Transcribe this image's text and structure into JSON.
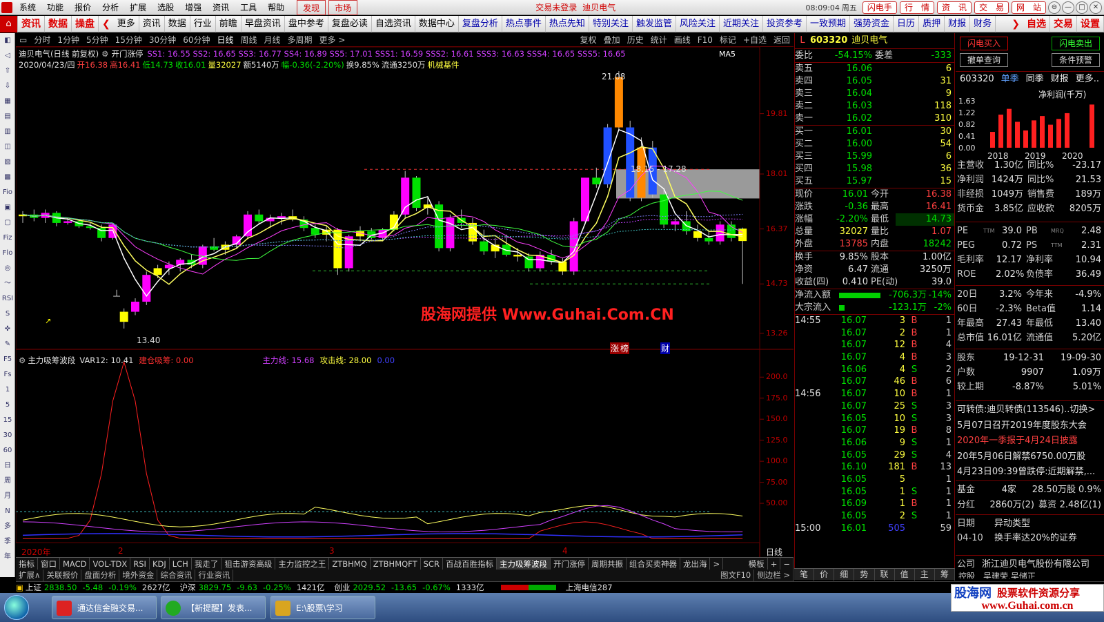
{
  "menubar": {
    "items": [
      "系统",
      "功能",
      "报价",
      "分析",
      "扩展",
      "选股",
      "增强",
      "资讯",
      "工具",
      "帮助"
    ],
    "discover": "发现",
    "market": "市场",
    "status": "交易未登录",
    "stock_name": "迪贝电气",
    "time": "08:09:04",
    "weekday": "周五",
    "buttons": [
      "闪电手",
      "行　情",
      "资　讯",
      "交　易",
      "网　站"
    ]
  },
  "toolbar": {
    "hot": [
      "资讯",
      "数据",
      "操盘"
    ],
    "items": [
      "更多",
      "资讯",
      "数据",
      "行业",
      "前瞻",
      "早盘资讯",
      "盘中参考",
      "复盘必读",
      "自选资讯",
      "数据中心",
      "复盘分析",
      "热点事件",
      "热点先知",
      "特别关注",
      "触发监管",
      "风险关注",
      "近期关注",
      "投资参考",
      "一致预期",
      "强势资金",
      "日历",
      "质押",
      "财报",
      "财务"
    ],
    "right": [
      "自选",
      "交易",
      "设置"
    ]
  },
  "lefttb": [
    "◧",
    "◁",
    "⇧",
    "⇩",
    "▦",
    "▤",
    "▥",
    "◫",
    "▨",
    "▩",
    "Fio",
    "▣",
    "▢",
    "Fiz",
    "Flo",
    "◎",
    "〜",
    "RSI",
    "S",
    "✜",
    "✎",
    "F5",
    "Fs",
    "1",
    "5",
    "15",
    "30",
    "60",
    "日",
    "周",
    "月",
    "N",
    "多",
    "季",
    "年"
  ],
  "periods": {
    "items": [
      "分时",
      "1分钟",
      "5分钟",
      "15分钟",
      "30分钟",
      "60分钟",
      "日线",
      "周线",
      "月线",
      "多周期",
      "更多 >"
    ],
    "tools": [
      "复权",
      "叠加",
      "历史",
      "统计",
      "画线",
      "F10",
      "标记",
      "+自选",
      "返回"
    ]
  },
  "chart_info": {
    "title": "迪贝电气(日线 前复权)",
    "indicator": "开门涨停",
    "ss": "SS1: 16.55  SS2: 16.65  SS3: 16.77  SS4: 16.89  SS5: 17.01  SSS1: 16.59  SSS2: 16.61  SSS3: 16.63  SSS4: 16.65  SSS5: 16.65",
    "ma_tag": "MA5",
    "date": "2020/04/23/四",
    "open_lbl": "开",
    "open": "16.38",
    "high_lbl": "高",
    "high": "16.41",
    "low_lbl": "低",
    "low": "14.73",
    "close_lbl": "收",
    "close": "16.01",
    "vol": "量32027",
    "amt": "额5140万",
    "chg": "幅-0.36(-2.20%)",
    "turn": "换9.85%",
    "float": "流通3250万",
    "sector": "机械基件",
    "high_mark": "21.08",
    "low_mark": "13.40",
    "range_label": "18.15 - 17.28",
    "watermark": "股海网提供 Www.Guhai.Com.CN",
    "badge1": "涨",
    "badge2": "榜",
    "badge3": "财",
    "star_b": "B"
  },
  "main_yaxis": [
    "19.81",
    "18.01",
    "16.37",
    "14.73",
    "13.26"
  ],
  "sub_info": {
    "name": "主力吸筹波段",
    "var12": "VAR12: 10.41",
    "build": "建仓吸筹: 0.00",
    "main_line": "主力线: 15.68",
    "attack": "攻击线: 28.00",
    "extra": "0.00"
  },
  "sub_yaxis": [
    "200.0",
    "175.0",
    "150.0",
    "125.0",
    "100.0",
    "75.00",
    "50.00"
  ],
  "xaxis": {
    "labels": [
      "2020年",
      "2",
      "3",
      "4"
    ],
    "period_tag": "日线"
  },
  "chart_data": {
    "type": "candlestick",
    "period": "日线",
    "price_axis": {
      "ticks": [
        19.81,
        18.01,
        16.37,
        14.73,
        13.26
      ]
    },
    "annotations": {
      "high": 21.08,
      "low": 13.4,
      "range": [
        18.15,
        17.28
      ]
    },
    "last_bar": {
      "date": "2020/04/23",
      "open": 16.38,
      "high": 16.41,
      "low": 14.73,
      "close": 16.01
    },
    "candles": [
      {
        "o": 16.75,
        "h": 16.9,
        "l": 16.55,
        "c": 16.8
      },
      {
        "o": 16.8,
        "h": 16.95,
        "l": 16.6,
        "c": 16.7
      },
      {
        "o": 16.7,
        "h": 16.95,
        "l": 16.55,
        "c": 16.85
      },
      {
        "o": 16.85,
        "h": 16.9,
        "l": 16.45,
        "c": 16.55
      },
      {
        "o": 16.55,
        "h": 16.7,
        "l": 16.5,
        "c": 16.6
      },
      {
        "o": 16.6,
        "h": 16.65,
        "l": 16.4,
        "c": 16.45
      },
      {
        "o": 16.45,
        "h": 16.55,
        "l": 16.35,
        "c": 16.4
      },
      {
        "o": 16.4,
        "h": 16.5,
        "l": 16.0,
        "c": 16.1
      },
      {
        "o": 16.1,
        "h": 16.55,
        "l": 16.05,
        "c": 16.5
      },
      {
        "o": 13.6,
        "h": 14.0,
        "l": 13.4,
        "c": 13.9
      },
      {
        "o": 13.9,
        "h": 14.3,
        "l": 13.8,
        "c": 14.2
      },
      {
        "o": 14.2,
        "h": 15.1,
        "l": 14.1,
        "c": 15.0
      },
      {
        "o": 15.0,
        "h": 15.3,
        "l": 14.9,
        "c": 15.2
      },
      {
        "o": 15.2,
        "h": 15.4,
        "l": 15.0,
        "c": 15.3
      },
      {
        "o": 15.3,
        "h": 15.5,
        "l": 15.1,
        "c": 15.45
      },
      {
        "o": 15.45,
        "h": 15.6,
        "l": 15.2,
        "c": 15.3
      },
      {
        "o": 15.3,
        "h": 15.9,
        "l": 15.2,
        "c": 15.85
      },
      {
        "o": 15.85,
        "h": 16.1,
        "l": 15.7,
        "c": 15.75
      },
      {
        "o": 15.75,
        "h": 16.0,
        "l": 15.6,
        "c": 15.9
      },
      {
        "o": 15.9,
        "h": 16.2,
        "l": 15.8,
        "c": 16.15
      },
      {
        "o": 16.15,
        "h": 16.9,
        "l": 16.1,
        "c": 16.8
      },
      {
        "o": 16.8,
        "h": 16.95,
        "l": 16.5,
        "c": 16.6
      },
      {
        "o": 16.6,
        "h": 16.8,
        "l": 16.4,
        "c": 16.7
      },
      {
        "o": 16.7,
        "h": 16.85,
        "l": 16.5,
        "c": 16.75
      },
      {
        "o": 16.75,
        "h": 16.95,
        "l": 16.6,
        "c": 16.65
      },
      {
        "o": 16.65,
        "h": 16.75,
        "l": 16.3,
        "c": 16.4
      },
      {
        "o": 16.4,
        "h": 16.5,
        "l": 16.1,
        "c": 16.2
      },
      {
        "o": 16.2,
        "h": 16.45,
        "l": 16.0,
        "c": 16.35
      },
      {
        "o": 16.35,
        "h": 16.4,
        "l": 15.0,
        "c": 15.2
      },
      {
        "o": 15.2,
        "h": 16.2,
        "l": 15.1,
        "c": 16.15
      },
      {
        "o": 16.15,
        "h": 16.45,
        "l": 16.0,
        "c": 16.3
      },
      {
        "o": 16.3,
        "h": 16.4,
        "l": 16.05,
        "c": 16.1
      },
      {
        "o": 16.1,
        "h": 16.4,
        "l": 16.0,
        "c": 16.35
      },
      {
        "o": 16.35,
        "h": 16.9,
        "l": 16.3,
        "c": 16.8
      },
      {
        "o": 16.8,
        "h": 18.1,
        "l": 16.7,
        "c": 17.9
      },
      {
        "o": 17.9,
        "h": 17.95,
        "l": 16.9,
        "c": 17.0
      },
      {
        "o": 17.0,
        "h": 17.3,
        "l": 16.8,
        "c": 17.1
      },
      {
        "o": 17.1,
        "h": 17.2,
        "l": 15.7,
        "c": 15.8
      },
      {
        "o": 15.8,
        "h": 16.8,
        "l": 15.7,
        "c": 16.7
      },
      {
        "o": 16.7,
        "h": 16.95,
        "l": 16.4,
        "c": 16.55
      },
      {
        "o": 16.55,
        "h": 16.7,
        "l": 15.9,
        "c": 16.0
      },
      {
        "o": 16.0,
        "h": 16.35,
        "l": 15.6,
        "c": 15.7
      },
      {
        "o": 15.7,
        "h": 16.1,
        "l": 15.5,
        "c": 15.9
      },
      {
        "o": 15.9,
        "h": 16.2,
        "l": 15.55,
        "c": 15.6
      },
      {
        "o": 15.6,
        "h": 15.8,
        "l": 15.4,
        "c": 15.55
      },
      {
        "o": 15.55,
        "h": 15.65,
        "l": 15.1,
        "c": 15.2
      },
      {
        "o": 15.2,
        "h": 15.7,
        "l": 15.1,
        "c": 15.6
      },
      {
        "o": 15.6,
        "h": 15.75,
        "l": 15.3,
        "c": 15.4
      },
      {
        "o": 15.4,
        "h": 15.5,
        "l": 15.0,
        "c": 15.1
      },
      {
        "o": 15.1,
        "h": 16.7,
        "l": 15.0,
        "c": 16.6
      },
      {
        "o": 16.6,
        "h": 17.3,
        "l": 16.5,
        "c": 17.9
      },
      {
        "o": 17.9,
        "h": 18.2,
        "l": 17.6,
        "c": 17.7
      },
      {
        "o": 17.7,
        "h": 19.5,
        "l": 17.6,
        "c": 19.4
      },
      {
        "o": 19.4,
        "h": 21.08,
        "l": 19.3,
        "c": 20.9
      },
      {
        "o": 19.4,
        "h": 19.6,
        "l": 17.2,
        "c": 17.3
      },
      {
        "o": 17.3,
        "h": 19.1,
        "l": 17.2,
        "c": 18.8
      },
      {
        "o": 18.8,
        "h": 19.0,
        "l": 17.3,
        "c": 17.4
      },
      {
        "o": 17.4,
        "h": 17.6,
        "l": 16.4,
        "c": 16.5
      },
      {
        "o": 16.5,
        "h": 16.7,
        "l": 16.3,
        "c": 16.6
      },
      {
        "o": 16.6,
        "h": 16.9,
        "l": 16.2,
        "c": 16.3
      },
      {
        "o": 16.3,
        "h": 16.5,
        "l": 16.0,
        "c": 16.1
      },
      {
        "o": 16.1,
        "h": 16.3,
        "l": 15.9,
        "c": 16.0
      },
      {
        "o": 16.0,
        "h": 16.6,
        "l": 15.9,
        "c": 16.5
      },
      {
        "o": 16.5,
        "h": 16.6,
        "l": 16.0,
        "c": 16.1
      },
      {
        "o": 16.38,
        "h": 16.41,
        "l": 14.73,
        "c": 16.01
      }
    ],
    "sub_series": {
      "name": "主力吸筹波段",
      "axis_ticks": [
        200.0,
        175.0,
        150.0,
        125.0,
        100.0,
        75.0,
        50.0
      ]
    }
  },
  "quote": {
    "code": "603320",
    "name": "迪贝电气",
    "weibi_lbl": "委比",
    "weibi": "-54.15%",
    "weicha_lbl": "委差",
    "weicha": "-333",
    "asks": [
      {
        "lbl": "卖五",
        "p": "16.06",
        "v": "6"
      },
      {
        "lbl": "卖四",
        "p": "16.05",
        "v": "31"
      },
      {
        "lbl": "卖三",
        "p": "16.04",
        "v": "9"
      },
      {
        "lbl": "卖二",
        "p": "16.03",
        "v": "118"
      },
      {
        "lbl": "卖一",
        "p": "16.02",
        "v": "310"
      }
    ],
    "bids": [
      {
        "lbl": "买一",
        "p": "16.01",
        "v": "30"
      },
      {
        "lbl": "买二",
        "p": "16.00",
        "v": "54"
      },
      {
        "lbl": "买三",
        "p": "15.99",
        "v": "6"
      },
      {
        "lbl": "买四",
        "p": "15.98",
        "v": "36"
      },
      {
        "lbl": "买五",
        "p": "15.97",
        "v": "15"
      }
    ],
    "stats": [
      {
        "a": "现价",
        "av": "16.01",
        "b": "今开",
        "bv": "16.38"
      },
      {
        "a": "涨跌",
        "av": "-0.36",
        "b": "最高",
        "bv": "16.41"
      },
      {
        "a": "涨幅",
        "av": "-2.20%",
        "b": "最低",
        "bv": "14.73"
      },
      {
        "a": "总量",
        "av": "32027",
        "b": "量比",
        "bv": "1.07"
      },
      {
        "a": "外盘",
        "av": "13785",
        "b": "内盘",
        "bv": "18242"
      }
    ],
    "stats2": [
      {
        "a": "换手",
        "av": "9.85%",
        "b": "股本",
        "bv": "1.00亿"
      },
      {
        "a": "净资",
        "av": "6.47",
        "b": "流通",
        "bv": "3250万"
      },
      {
        "a": "收益(四)",
        "av": "0.410",
        "b": "PE(动)",
        "bv": "39.0"
      }
    ],
    "flow": [
      {
        "lbl": "净流入额",
        "v": "-706.3万",
        "p": "-14%"
      },
      {
        "lbl": "大宗流入",
        "v": "-123.1万",
        "p": "-2%"
      }
    ],
    "ticks": [
      {
        "t": "14:55",
        "p": "16.07",
        "v": "3",
        "d": "B",
        "n": "1"
      },
      {
        "t": "",
        "p": "16.07",
        "v": "2",
        "d": "B",
        "n": "1"
      },
      {
        "t": "",
        "p": "16.07",
        "v": "12",
        "d": "B",
        "n": "4"
      },
      {
        "t": "",
        "p": "16.07",
        "v": "4",
        "d": "B",
        "n": "3"
      },
      {
        "t": "",
        "p": "16.06",
        "v": "4",
        "d": "S",
        "n": "2"
      },
      {
        "t": "",
        "p": "16.07",
        "v": "46",
        "d": "B",
        "n": "6"
      },
      {
        "t": "14:56",
        "p": "16.07",
        "v": "10",
        "d": "B",
        "n": "1"
      },
      {
        "t": "",
        "p": "16.07",
        "v": "25",
        "d": "S",
        "n": "3"
      },
      {
        "t": "",
        "p": "16.05",
        "v": "10",
        "d": "S",
        "n": "3"
      },
      {
        "t": "",
        "p": "16.07",
        "v": "19",
        "d": "B",
        "n": "8"
      },
      {
        "t": "",
        "p": "16.06",
        "v": "9",
        "d": "S",
        "n": "1"
      },
      {
        "t": "",
        "p": "16.05",
        "v": "29",
        "d": "S",
        "n": "4"
      },
      {
        "t": "",
        "p": "16.10",
        "v": "181",
        "d": "B",
        "n": "13"
      },
      {
        "t": "",
        "p": "16.05",
        "v": "5",
        "d": "",
        "n": "1"
      },
      {
        "t": "",
        "p": "16.05",
        "v": "1",
        "d": "S",
        "n": "1"
      },
      {
        "t": "",
        "p": "16.09",
        "v": "1",
        "d": "B",
        "n": "1"
      },
      {
        "t": "",
        "p": "16.05",
        "v": "2",
        "d": "S",
        "n": "1"
      },
      {
        "t": "15:00",
        "p": "16.01",
        "v": "505",
        "d": "",
        "n": "59"
      }
    ],
    "bottom_tabs": [
      "笔",
      "价",
      "细",
      "势",
      "联",
      "值",
      "主",
      "筹"
    ]
  },
  "f10": {
    "buttons": {
      "flash_buy": "闪电买入",
      "flash_sell": "闪电卖出",
      "order_query": "撤单查询",
      "cond_alert": "条件预警"
    },
    "code": "603320",
    "tabs": [
      "单季",
      "同季",
      "财报",
      "更多.."
    ],
    "profit_title": "净利润(千万)",
    "bar_yticks": [
      "1.63",
      "1.22",
      "0.82",
      "0.41",
      "0.00"
    ],
    "bar_years": [
      "2018",
      "2019",
      "2020"
    ],
    "bar_values": [
      0.55,
      1.15,
      1.35,
      0.9,
      0.6,
      0.95,
      1.1,
      0.8,
      1.0,
      1.2,
      0.0,
      0.0,
      1.5
    ],
    "fin": [
      {
        "a": "主营收",
        "av": "1.30亿",
        "b": "同比%",
        "bv": "-23.17"
      },
      {
        "a": "净利润",
        "av": "1424万",
        "b": "同比%",
        "bv": "21.53"
      },
      {
        "a": "非经损",
        "av": "1049万",
        "b": "销售费",
        "bv": "189万"
      },
      {
        "a": "货币金",
        "av": "3.85亿",
        "b": "应收款",
        "bv": "8205万"
      }
    ],
    "val": [
      {
        "a": "PE",
        "as": "TTM",
        "av": "39.0",
        "b": "PB",
        "bs": "MRQ",
        "bv": "2.48"
      },
      {
        "a": "PEG",
        "as": "",
        "av": "0.72",
        "b": "PS",
        "bs": "TTM",
        "bv": "2.31"
      },
      {
        "a": "毛利率",
        "as": "",
        "av": "12.17",
        "b": "净利率",
        "bs": "",
        "bv": "10.94"
      },
      {
        "a": "ROE",
        "as": "",
        "av": "2.02%",
        "b": "负债率",
        "bs": "",
        "bv": "36.49"
      }
    ],
    "perf": [
      {
        "a": "20日",
        "av": "3.2%",
        "b": "今年来",
        "bv": "-4.9%"
      },
      {
        "a": "60日",
        "av": "-2.3%",
        "b": "Beta值",
        "bv": "1.14"
      },
      {
        "a": "年最高",
        "av": "27.43",
        "b": "年最低",
        "bv": "13.40"
      },
      {
        "a": "总市值",
        "av": "16.01亿",
        "b": "流通值",
        "bv": "5.20亿"
      }
    ],
    "holders": [
      {
        "a": "股东",
        "av": "19-12-31",
        "bv": "19-09-30"
      },
      {
        "a": "户数",
        "av": "9907",
        "bv": "1.09万"
      },
      {
        "a": "较上期",
        "av": "-8.87%",
        "bv": "5.01%"
      }
    ],
    "news": [
      {
        "text": "可转债:迪贝转债(113546)..切换>",
        "color": "#e0e0e0"
      },
      {
        "text": "5月07日召开2019年度股东大会",
        "color": "#e0e0e0"
      },
      {
        "text": "2020年一季报于4月24日披露",
        "color": "#ff4040"
      },
      {
        "text": "20年5月06日解禁6750.00万股",
        "color": "#e0e0e0"
      },
      {
        "text": "4月23日09:39曾跌停:近期解禁,...",
        "color": "#e0e0e0"
      }
    ],
    "fund": {
      "a": "基金",
      "n": "4家",
      "s": "28.50万股",
      "p": "0.9%"
    },
    "dividend": {
      "a": "分红",
      "v": "2860万(2)",
      "b": "募资",
      "bv": "2.48亿(1)"
    },
    "events": [
      {
        "a": "日期",
        "v": "异动类型"
      },
      {
        "a": "04-10",
        "v": "换手率达20%的证券"
      }
    ],
    "company": {
      "a": "公司",
      "v": "浙江迪贝电气股份有限公司"
    },
    "partial": "控股　吴建荣,吴储正"
  },
  "ind_tabs": [
    "指标",
    "窗口",
    "MACD",
    "VOL-TDX",
    "RSI",
    "KDJ",
    "LCH",
    "我走了",
    "狙击游资高级",
    "主力监控之王",
    "ZTBHMQ",
    "ZTBHMQFT",
    "SCR",
    "百战百胜指标",
    "主力吸筹波段",
    "开门涨停",
    "周期共振",
    "组合买卖神器",
    "龙出海",
    ">"
  ],
  "ind_tabs_sel": "主力吸筹波段",
  "ind_tabs_right": [
    "模板",
    "+",
    "−"
  ],
  "ext_tabs": [
    "扩展∧",
    "关联报价",
    "盘面分析",
    "境外资金",
    "综合资讯",
    "行业资讯"
  ],
  "ext_right": [
    "图文F10",
    "侧边栏 >"
  ],
  "ticker": [
    {
      "name": "上证",
      "v": "2838.50",
      "c": "-5.48",
      "p": "-0.19%",
      "a": "2627亿"
    },
    {
      "name": "沪深",
      "v": "3829.75",
      "c": "-9.63",
      "p": "-0.25%",
      "a": "1421亿"
    },
    {
      "name": "创业",
      "v": "2029.52",
      "c": "-13.65",
      "p": "-0.67%",
      "a": "1333亿"
    }
  ],
  "ticker_extra": "上海电信287",
  "taskbar": [
    {
      "label": "通达信金融交易..."
    },
    {
      "label": "【新提醒】发表..."
    },
    {
      "label": "E:\\股票\\学习"
    }
  ],
  "logo": {
    "main": "股海网",
    "sub": "股票软件资源分享",
    "url": "www.Guhai.com.cn"
  },
  "colors": {
    "up": "#ff3030",
    "down": "#00e050",
    "bg": "#000000",
    "axis": "#800000",
    "accent": "#d00000"
  }
}
